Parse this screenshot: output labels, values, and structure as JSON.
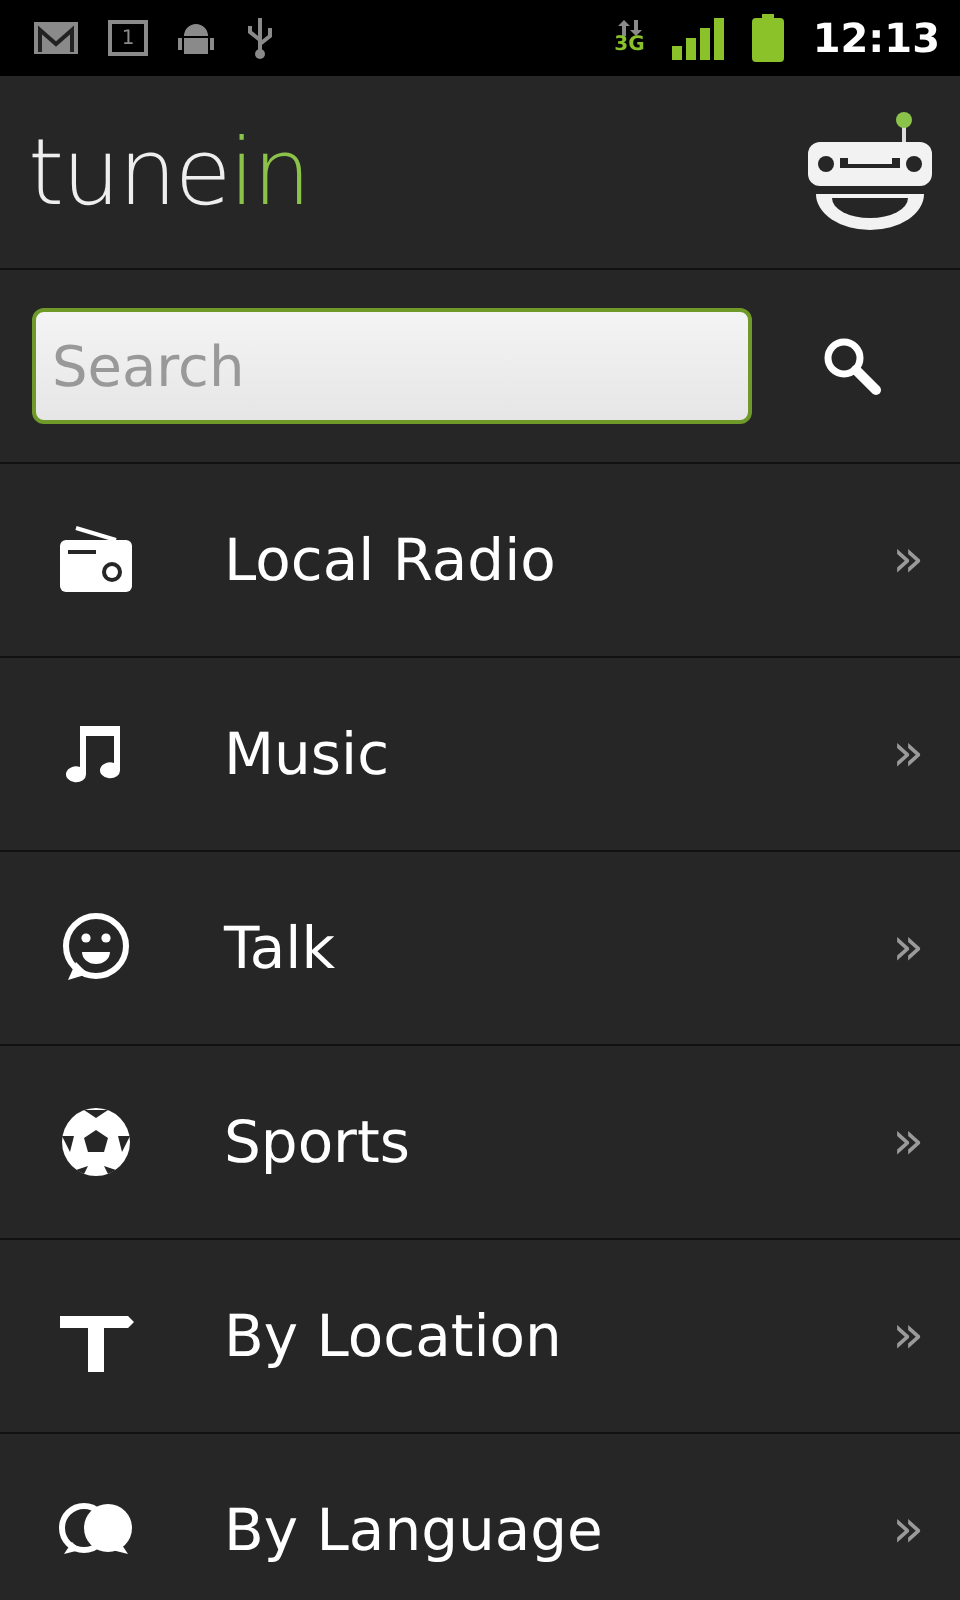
{
  "status_bar": {
    "calendar_day": "1",
    "network": "3G",
    "time": "12:13"
  },
  "header": {
    "logo": {
      "text": "tune",
      "accent": "in"
    }
  },
  "search": {
    "placeholder": "Search"
  },
  "menu": [
    {
      "kind": "radio",
      "label": "Local Radio",
      "chevron": "»"
    },
    {
      "kind": "music",
      "label": "Music",
      "chevron": "»"
    },
    {
      "kind": "talk",
      "label": "Talk",
      "chevron": "»"
    },
    {
      "kind": "sports",
      "label": "Sports",
      "chevron": "»"
    },
    {
      "kind": "location",
      "label": "By Location",
      "chevron": "»"
    },
    {
      "kind": "language",
      "label": "By Language",
      "chevron": "»"
    }
  ]
}
